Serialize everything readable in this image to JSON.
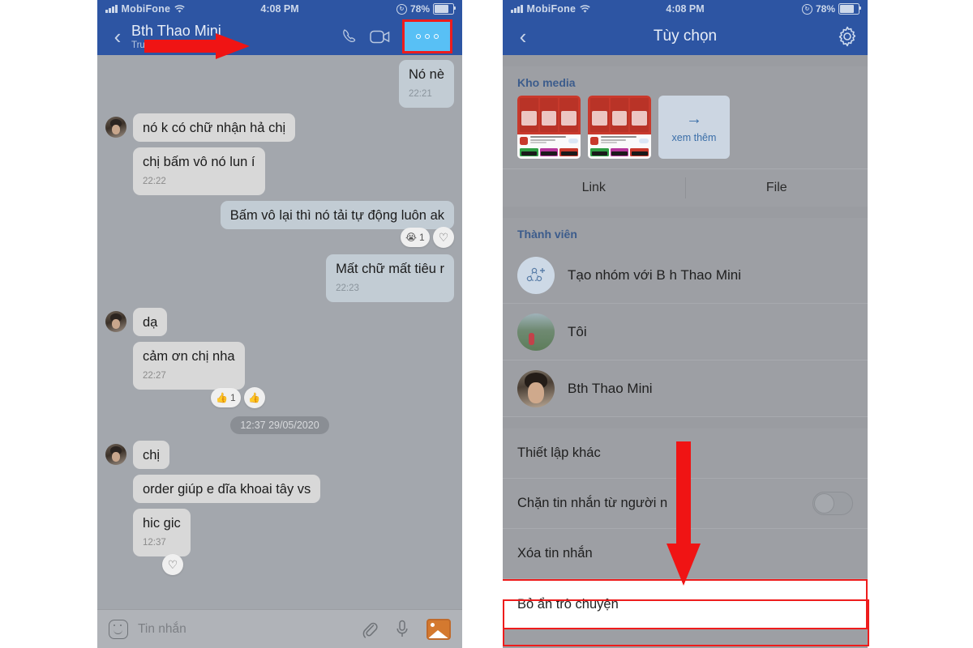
{
  "left_phone": {
    "statusbar": {
      "carrier": "MobiFone",
      "time": "4:08 PM",
      "battery": "78%",
      "wifi_icon": "wifi-icon",
      "signal_icon": "signal-bars-icon",
      "lock_icon": "rotation-lock-icon",
      "battery_icon": "battery-icon"
    },
    "navbar": {
      "back_icon": "chevron-left-icon",
      "title": "Bth Thao Mini",
      "subtitle": "Truy cập 46 phút trước",
      "call_icon": "phone-icon",
      "video_icon": "video-camera-icon",
      "more_icon": "more-options-icon"
    },
    "messages": [
      {
        "side": "me",
        "text": "Nó nè",
        "time": "22:21",
        "reactions": []
      },
      {
        "side": "them",
        "text": "nó k có chữ nhận hả chị",
        "time": "",
        "avatar": true,
        "reactions": []
      },
      {
        "side": "them",
        "text": "chị bấm vô nó lun í",
        "time": "22:22",
        "avatar": false,
        "reactions": []
      },
      {
        "side": "me",
        "text": "Bấm vô lại thì nó tải tự động luôn ak",
        "time": "",
        "reactions": [
          {
            "emoji": "😭",
            "count": "1"
          },
          {
            "emoji": "♡",
            "count": ""
          }
        ]
      },
      {
        "side": "me",
        "text": "Mất chữ mất tiêu r",
        "time": "22:23",
        "reactions": []
      },
      {
        "side": "them",
        "text": "dạ",
        "time": "",
        "avatar": true,
        "reactions": []
      },
      {
        "side": "them",
        "text": "cảm ơn chị nha",
        "time": "22:27",
        "avatar": false,
        "reactions": [
          {
            "emoji": "👍",
            "count": "1"
          },
          {
            "emoji": "👍",
            "count": ""
          }
        ]
      }
    ],
    "daystamp": "12:37 29/05/2020",
    "messages_after": [
      {
        "side": "them",
        "text": "chị",
        "time": "",
        "avatar": true,
        "reactions": []
      },
      {
        "side": "them",
        "text": "order giúp e dĩa khoai tây vs",
        "time": "",
        "avatar": false,
        "reactions": []
      },
      {
        "side": "them",
        "text": "hic gic",
        "time": "12:37",
        "avatar": false,
        "reactions": [
          {
            "emoji": "♡",
            "count": ""
          }
        ]
      }
    ],
    "inputbar": {
      "emoji_icon": "emoji-smiley-icon",
      "placeholder": "Tin nhắn",
      "attach_icon": "paperclip-icon",
      "mic_icon": "microphone-icon",
      "photo_icon": "photo-gallery-icon"
    }
  },
  "right_phone": {
    "statusbar": {
      "carrier": "MobiFone",
      "time": "4:08 PM",
      "battery": "78%"
    },
    "navbar": {
      "back_icon": "chevron-left-icon",
      "title": "Tùy chọn",
      "settings_icon": "gear-icon"
    },
    "media_section": {
      "heading": "Kho media",
      "see_more_label": "xem thêm",
      "see_more_arrow": "arrow-right-icon",
      "thumbnails": [
        "media-thumbnail-1",
        "media-thumbnail-2"
      ]
    },
    "link_file_tabs": [
      {
        "label": "Link"
      },
      {
        "label": "File"
      }
    ],
    "members_section": {
      "heading": "Thành viên",
      "items": [
        {
          "label": "Tạo nhóm với B h Thao Mini",
          "avatar": "add-group-icon"
        },
        {
          "label": "Tôi",
          "avatar": "user-avatar-photo"
        },
        {
          "label": "Bth Thao Mini",
          "avatar": "user-avatar-photo"
        }
      ]
    },
    "settings_rows": [
      {
        "label": "Thiết lập khác",
        "toggle": false,
        "highlight": false
      },
      {
        "label": "Chặn tin nhắn từ người n",
        "toggle": true,
        "toggle_on": false,
        "highlight": false
      },
      {
        "label": "Xóa tin nhắn",
        "toggle": false,
        "highlight": false
      },
      {
        "label": "Bỏ ẩn trò chuyện",
        "toggle": false,
        "highlight": true
      }
    ]
  },
  "annotations": {
    "arrow_right": "red-arrow-right",
    "arrow_down": "red-arrow-down",
    "highlight_color": "#ee1c1c",
    "highlight_button_color": "#58c0f5"
  }
}
